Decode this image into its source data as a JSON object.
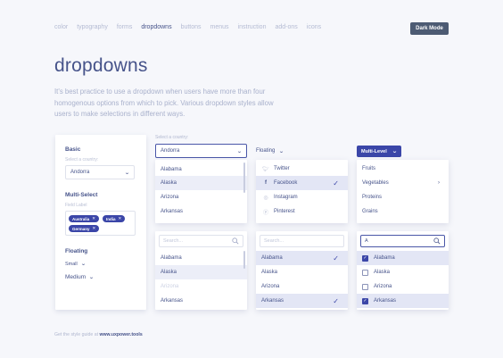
{
  "nav": {
    "items": [
      "color",
      "typography",
      "forms",
      "dropdowns",
      "buttons",
      "menus",
      "instruction",
      "add-ons",
      "icons"
    ],
    "dark_mode_label": "Dark Mode"
  },
  "heading": {
    "title": "dropdowns",
    "intro": "It's best practice to use a dropdown when users have more than four homogenous options from which to pick. Various dropdown styles allow users to make selections in different ways."
  },
  "left_panel": {
    "basic_title": "Basic",
    "basic_label": "Select a country:",
    "basic_value": "Andorra",
    "multi_title": "Multi-Select",
    "multi_label": "Field Label",
    "tags": [
      "Australia",
      "India",
      "Germany"
    ],
    "floating_title": "Floating",
    "small_label": "Small",
    "medium_label": "Medium"
  },
  "country_select": {
    "label": "Select a country:",
    "value": "Andorra"
  },
  "floating_header": "Floating",
  "multilevel_header": "Multi-Level",
  "list_countries": [
    "Alabama",
    "Alaska",
    "Arizona",
    "Arkansas"
  ],
  "list_social": [
    "Twitter",
    "Facebook",
    "Instagram",
    "Pinterest"
  ],
  "list_food": [
    "Fruits",
    "Vegetables",
    "Proteins",
    "Grains"
  ],
  "search_placeholder": "Search...",
  "search_query": "A",
  "search_list_1": [
    "Alabama",
    "Alaska",
    "Arizona",
    "Arkansas"
  ],
  "search_list_2": [
    "Alabama",
    "Alaska",
    "Arizona",
    "Arkansas"
  ],
  "search_list_3": [
    "Alabama",
    "Alaska",
    "Arizona",
    "Arkansas"
  ],
  "footer": {
    "prefix": "Get the style guide at",
    "link": "www.uxpower.tools"
  }
}
